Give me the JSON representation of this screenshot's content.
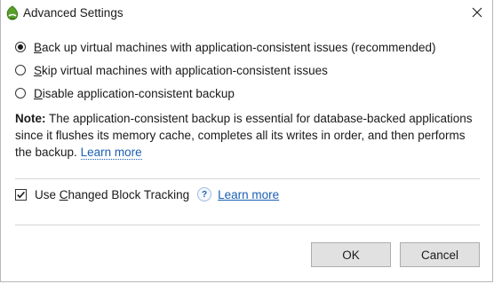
{
  "window": {
    "title": "Advanced Settings",
    "app_icon": "veeam-green-icon",
    "close_icon": "close-icon"
  },
  "options": [
    {
      "label": "Back up virtual machines with application-consistent issues (recommended)",
      "mnemonic": "B",
      "rest": "ack up virtual machines with application-consistent issues (recommended)",
      "selected": true
    },
    {
      "label": "Skip virtual machines with application-consistent issues",
      "mnemonic": "S",
      "rest": "kip virtual machines with application-consistent issues",
      "selected": false
    },
    {
      "label": "Disable application-consistent backup",
      "mnemonic": "D",
      "rest": "isable application-consistent backup",
      "selected": false
    }
  ],
  "note": {
    "prefix": "Note:",
    "text": " The application-consistent backup is essential for database-backed applications since it flushes its memory cache, completes all its writes in order, and then performs the backup. ",
    "link": "Learn more"
  },
  "cbt": {
    "label_pre": "Use ",
    "mnemonic": "C",
    "label_post": "hanged Block Tracking",
    "checked": true,
    "help_icon_glyph": "?",
    "link": "Learn more"
  },
  "buttons": {
    "ok": "OK",
    "cancel": "Cancel"
  }
}
